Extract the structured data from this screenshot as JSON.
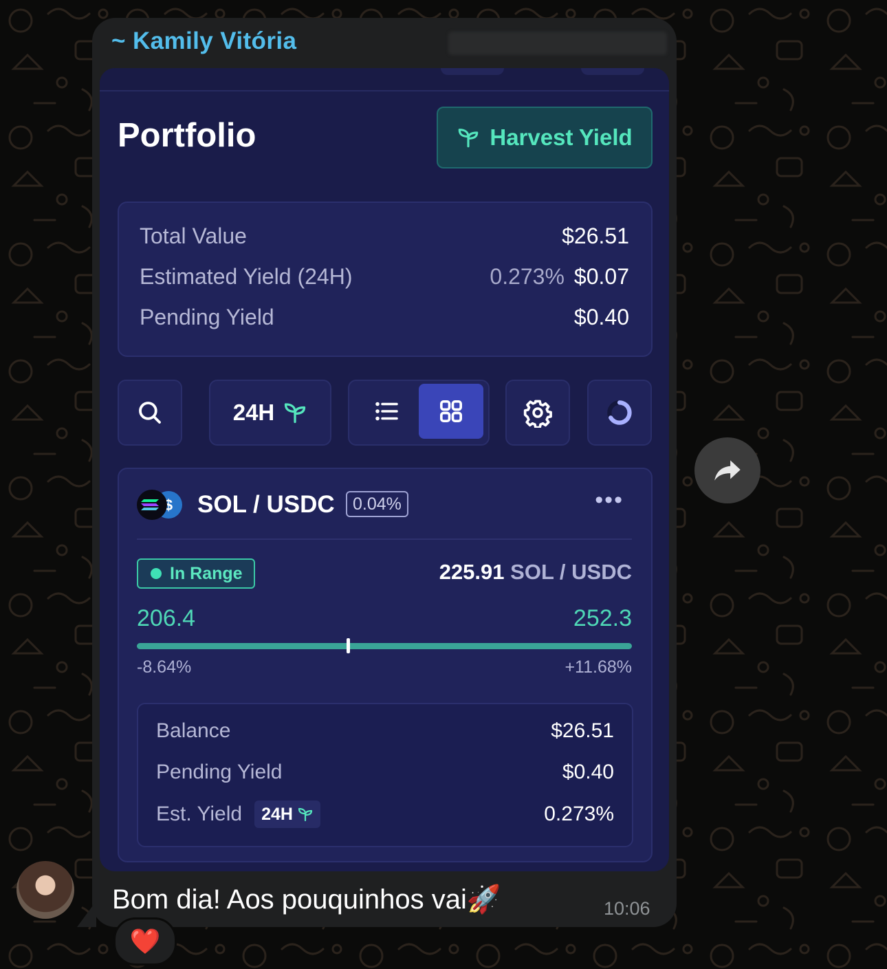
{
  "chat": {
    "sender": "~ Kamily Vitória",
    "message": "Bom dia! Aos pouquinhos vai",
    "message_emoji": "🚀",
    "time": "10:06",
    "reaction": "❤️"
  },
  "portfolio": {
    "title": "Portfolio",
    "harvest_button": "Harvest Yield",
    "summary": {
      "total_value_label": "Total Value",
      "total_value": "$26.51",
      "est_yield_label": "Estimated Yield (24H)",
      "est_yield_pct": "0.273%",
      "est_yield_value": "$0.07",
      "pending_label": "Pending Yield",
      "pending_value": "$0.40"
    },
    "toolbar": {
      "period": "24H"
    },
    "position": {
      "pair": "SOL / USDC",
      "fee": "0.04%",
      "status": "In Range",
      "current_price": "225.91",
      "price_unit": "SOL / USDC",
      "range_low": "206.4",
      "range_high": "252.3",
      "range_low_pct": "-8.64%",
      "range_high_pct": "+11.68%",
      "range_fraction": 0.426,
      "balance_label": "Balance",
      "balance": "$26.51",
      "pending_label": "Pending Yield",
      "pending": "$0.40",
      "est_yield_label": "Est. Yield",
      "est_yield_period": "24H",
      "est_yield": "0.273%"
    }
  },
  "colors": {
    "accent_green": "#55e6bd",
    "card_bg": "#20235a",
    "active_tab": "#3a45b8",
    "sender_name": "#53bdeb"
  }
}
